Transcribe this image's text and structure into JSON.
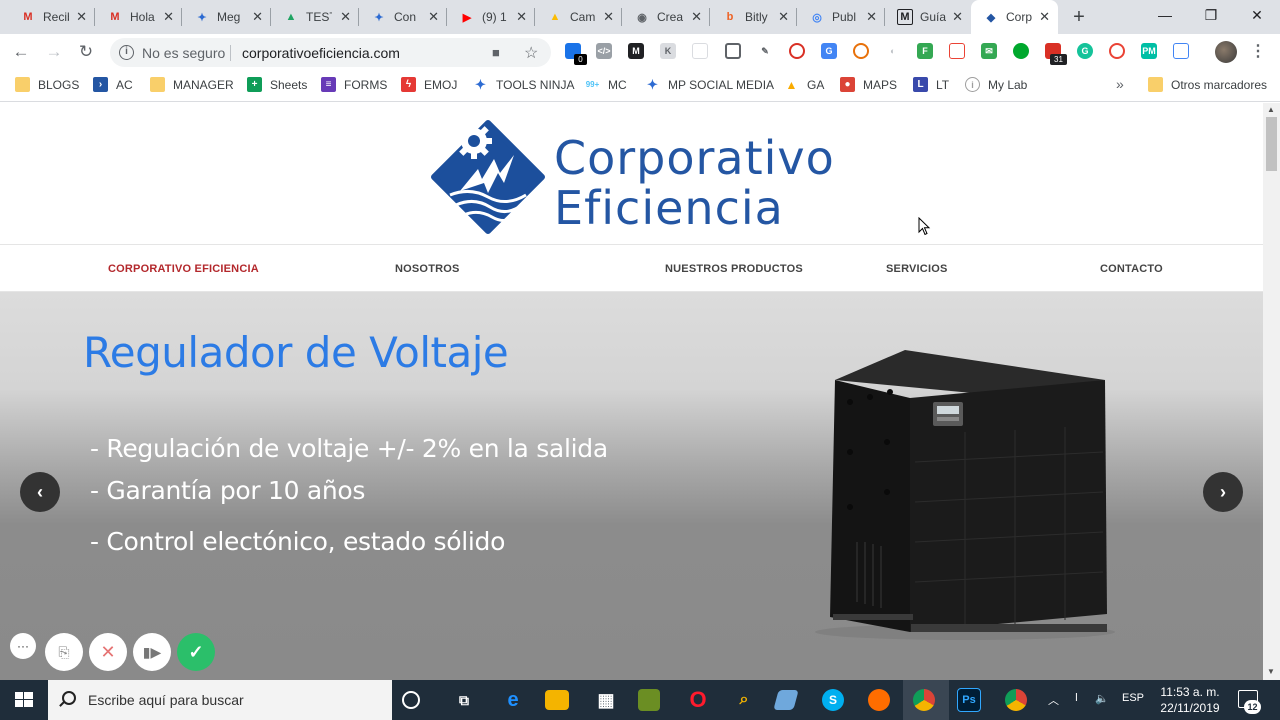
{
  "browser": {
    "tabs": [
      {
        "title": "Recib",
        "icon": "M",
        "color": "#d93025"
      },
      {
        "title": "Hola",
        "icon": "M",
        "color": "#d93025"
      },
      {
        "title": "Meg",
        "icon": "✦",
        "color": "#2d6bd2"
      },
      {
        "title": "TEST",
        "icon": "▲",
        "color": "#1fa463"
      },
      {
        "title": "Con",
        "icon": "✦",
        "color": "#2d6bd2"
      },
      {
        "title": "(9) 1",
        "icon": "▶",
        "color": "#ff0000"
      },
      {
        "title": "Cam",
        "icon": "▲",
        "color": "#fbbc04"
      },
      {
        "title": "Crea",
        "icon": "◉",
        "color": "#5f6368"
      },
      {
        "title": "Bitly",
        "icon": "b",
        "color": "#ee6123"
      },
      {
        "title": "Publ",
        "icon": "◎",
        "color": "#4285f4"
      },
      {
        "title": "Guía",
        "icon": "M",
        "color": "#202124"
      },
      {
        "title": "Corp",
        "icon": "◆",
        "color": "#2456a3"
      }
    ],
    "security_label": "No es seguro",
    "url": "corporativoeficiencia.com",
    "bookmarks": [
      {
        "label": "BLOGS",
        "type": "folder"
      },
      {
        "label": "AC",
        "type": "link",
        "color": "#2456a3"
      },
      {
        "label": "MANAGER",
        "type": "folder"
      },
      {
        "label": "Sheets",
        "type": "link",
        "color": "#0f9d58"
      },
      {
        "label": "FORMS",
        "type": "link",
        "color": "#673ab7"
      },
      {
        "label": "EMOJ",
        "type": "link",
        "color": "#e53935"
      },
      {
        "label": "TOOLS NINJA",
        "type": "link",
        "color": "#2d6bd2"
      },
      {
        "label": "MC",
        "type": "link",
        "color": "#4fc3f7"
      },
      {
        "label": "MP SOCIAL MEDIA",
        "type": "link",
        "color": "#2d6bd2"
      },
      {
        "label": "GA",
        "type": "link",
        "color": "#f9ab00"
      },
      {
        "label": "MAPS",
        "type": "link",
        "color": "#db4437"
      },
      {
        "label": "LT",
        "type": "link",
        "color": "#3949ab"
      },
      {
        "label": "My Lab",
        "type": "link",
        "color": "#9e9e9e"
      }
    ],
    "bookmarks_more": "»",
    "other_bookmarks": "Otros marcadores"
  },
  "site": {
    "logo_line1": "Corporativo",
    "logo_line2": "Eficiencia",
    "nav": [
      {
        "label": "CORPORATIVO EFICIENCIA",
        "active": true
      },
      {
        "label": "NOSOTROS",
        "active": false
      },
      {
        "label": "NUESTROS PRODUCTOS",
        "active": false
      },
      {
        "label": "SERVICIOS",
        "active": false
      },
      {
        "label": "CONTACTO",
        "active": false
      }
    ],
    "hero": {
      "title": "Regulador de Voltaje",
      "bullets": [
        "- Regulación de voltaje +/- 2% en la salida",
        "- Garantía por 10 años",
        "- Control electónico, estado sólido"
      ],
      "prev_label": "‹",
      "next_label": "›"
    }
  },
  "taskbar": {
    "search_placeholder": "Escribe aquí para buscar",
    "language": "ESP",
    "time": "11:53 a. m.",
    "date": "22/11/2019",
    "notifications": "12"
  },
  "extensions_badges": {
    "first": "0",
    "calendar": "31"
  },
  "colors": {
    "brand_blue": "#2456a3",
    "hero_title": "#2c7be5",
    "nav_active": "#b3282c"
  }
}
